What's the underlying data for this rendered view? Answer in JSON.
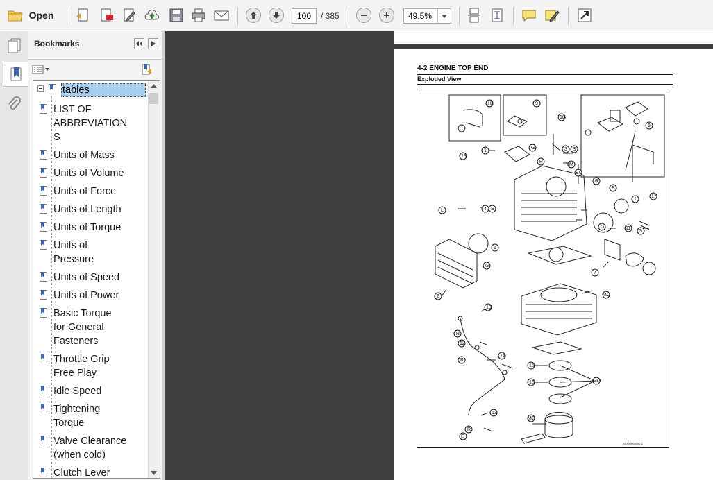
{
  "toolbar": {
    "open_label": "Open",
    "page_current": "100",
    "page_total": "/ 385",
    "zoom_value": "49.5%"
  },
  "panel": {
    "title": "Bookmarks",
    "root": "tables",
    "items": [
      {
        "lines": [
          "LIST OF",
          "ABBREVIATION",
          "S"
        ]
      },
      {
        "lines": [
          "Units of Mass"
        ]
      },
      {
        "lines": [
          "Units of Volume"
        ]
      },
      {
        "lines": [
          "Units of Force"
        ]
      },
      {
        "lines": [
          "Units of Length"
        ]
      },
      {
        "lines": [
          "Units of Torque"
        ]
      },
      {
        "lines": [
          "Units of",
          "Pressure"
        ]
      },
      {
        "lines": [
          "Units of Speed"
        ]
      },
      {
        "lines": [
          "Units of Power"
        ]
      },
      {
        "lines": [
          "Basic Torque",
          "for General",
          "Fasteners"
        ]
      },
      {
        "lines": [
          "Throttle Grip",
          "Free Play"
        ]
      },
      {
        "lines": [
          "Idle Speed"
        ]
      },
      {
        "lines": [
          "Tightening",
          "Torque"
        ]
      },
      {
        "lines": [
          "Valve Clearance",
          "(when cold)"
        ]
      },
      {
        "lines": [
          "Clutch Lever"
        ]
      }
    ]
  },
  "document": {
    "header": "4-2 ENGINE TOP END",
    "subheader": "Exploded View",
    "diagram_code": "XXXXXXX001 C",
    "callouts": [
      "10",
      "9",
      "18",
      "6",
      "19",
      "1",
      "G",
      "3",
      "S",
      "R",
      "M",
      "EO",
      "R",
      "B",
      "1",
      "4",
      "S",
      "L",
      "G",
      "11",
      "5",
      "6",
      "G",
      "7",
      "2",
      "MO",
      "13",
      "R",
      "12",
      "14",
      "R",
      "15",
      "16",
      "MO",
      "13",
      "R",
      "MO",
      "17",
      "E",
      "L",
      "R"
    ]
  }
}
